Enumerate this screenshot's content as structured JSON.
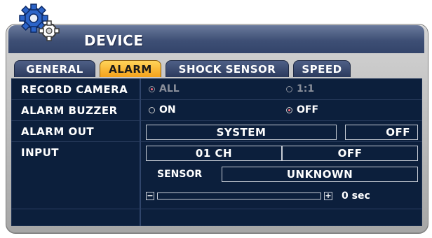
{
  "window": {
    "title": "DEVICE"
  },
  "tabs": [
    {
      "label": "GENERAL",
      "active": false
    },
    {
      "label": "ALARM",
      "active": true
    },
    {
      "label": "SHOCK SENSOR",
      "active": false
    },
    {
      "label": "SPEED",
      "active": false
    }
  ],
  "record_camera": {
    "label": "RECORD CAMERA",
    "options": [
      {
        "label": "ALL",
        "selected": true
      },
      {
        "label": "1:1",
        "selected": false
      }
    ]
  },
  "alarm_buzzer": {
    "label": "ALARM BUZZER",
    "options": [
      {
        "label": "ON",
        "selected": false
      },
      {
        "label": "OFF",
        "selected": true
      }
    ]
  },
  "alarm_out": {
    "label": "ALARM OUT",
    "mode": "SYSTEM",
    "state": "OFF"
  },
  "input": {
    "label": "INPUT",
    "channel": "01 CH",
    "state": "OFF",
    "sensor_label": "SENSOR",
    "sensor_value": "UNKNOWN",
    "duration_value": "0 sec",
    "slider_level": 0
  },
  "colors": {
    "accent_tab": "#f5a21b",
    "panel_bg": "#0c1f3c",
    "title_bar": "#3e4f75",
    "radio_selected": "#ff6a7a"
  },
  "icons": [
    "gears-logo-icon",
    "minus-icon",
    "plus-icon"
  ]
}
